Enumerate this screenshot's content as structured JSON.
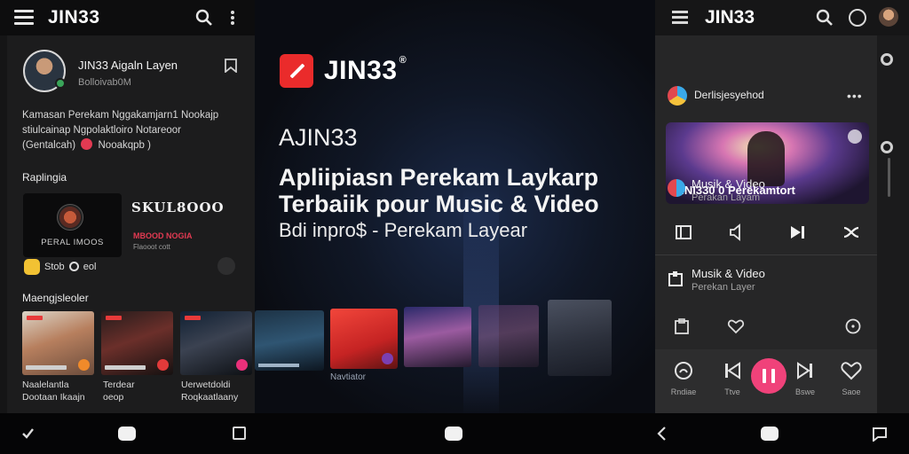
{
  "left_panel": {
    "app_title": "JIN33",
    "profile": {
      "name": "JIN33 Aigaln Layen",
      "subtitle": "Bolloivab0M"
    },
    "bio_lines": [
      "Kamasan Perekam Nggakamjarn1 Nookajp",
      "stiulcainap Ngpolaktloiro Notareoor",
      "(Gentalcah)"
    ],
    "bio_tail": "Nooakqpb )",
    "section_1": "Raplingia",
    "card_caption": "PERAL IMOOS",
    "artwork_text": "SKUL8OOO",
    "artwork_line1": "MBOOD NOGIA",
    "artwork_line2": "Flaooot cott",
    "reaction_text": "Stob",
    "reaction_tail": "eol",
    "section_2": "Maengjsleoler",
    "thumbnails": [
      {
        "line1": "Naalelantla",
        "line2": "Dootaan Ikaajn"
      },
      {
        "line1": "Terdear",
        "line2": "oeop"
      },
      {
        "line1": "Uerwetdoldi",
        "line2": "Roqkaatlaany"
      }
    ]
  },
  "center": {
    "logo_text": "JIN33",
    "logo_mark": "®",
    "heading_small": "AJIN33",
    "heading_big_line1": "Apliipiasn Perekam Laykarp",
    "heading_big_line2": "Terbaiik pour Music & Video",
    "heading_sub": "Bdi inpro$ - Perekam Layear",
    "thumb_caption": "Navtiator"
  },
  "right_panel": {
    "app_title": "JIN33",
    "channel_name": "Derlisjesyehod",
    "channel_more": "•••",
    "featured_caption": "JINI330 0 Perekamtort",
    "item_1": {
      "title": "Musik & Video",
      "subtitle": "Perakan Layam"
    },
    "item_2": {
      "title": "Musik & Video",
      "subtitle": "Perekan Layer"
    },
    "player_labels": [
      "Rndiae",
      "Ttve",
      "Bswe",
      "Saoe"
    ]
  },
  "icons": {
    "menu": "menu-icon",
    "search": "search-icon",
    "more": "more-vertical-icon",
    "bookmark": "bookmark-icon",
    "gear": "gear-icon"
  },
  "colors": {
    "accent_pink": "#f0427a",
    "brand_red": "#ea2b2b",
    "rec_red": "#e23a52"
  }
}
